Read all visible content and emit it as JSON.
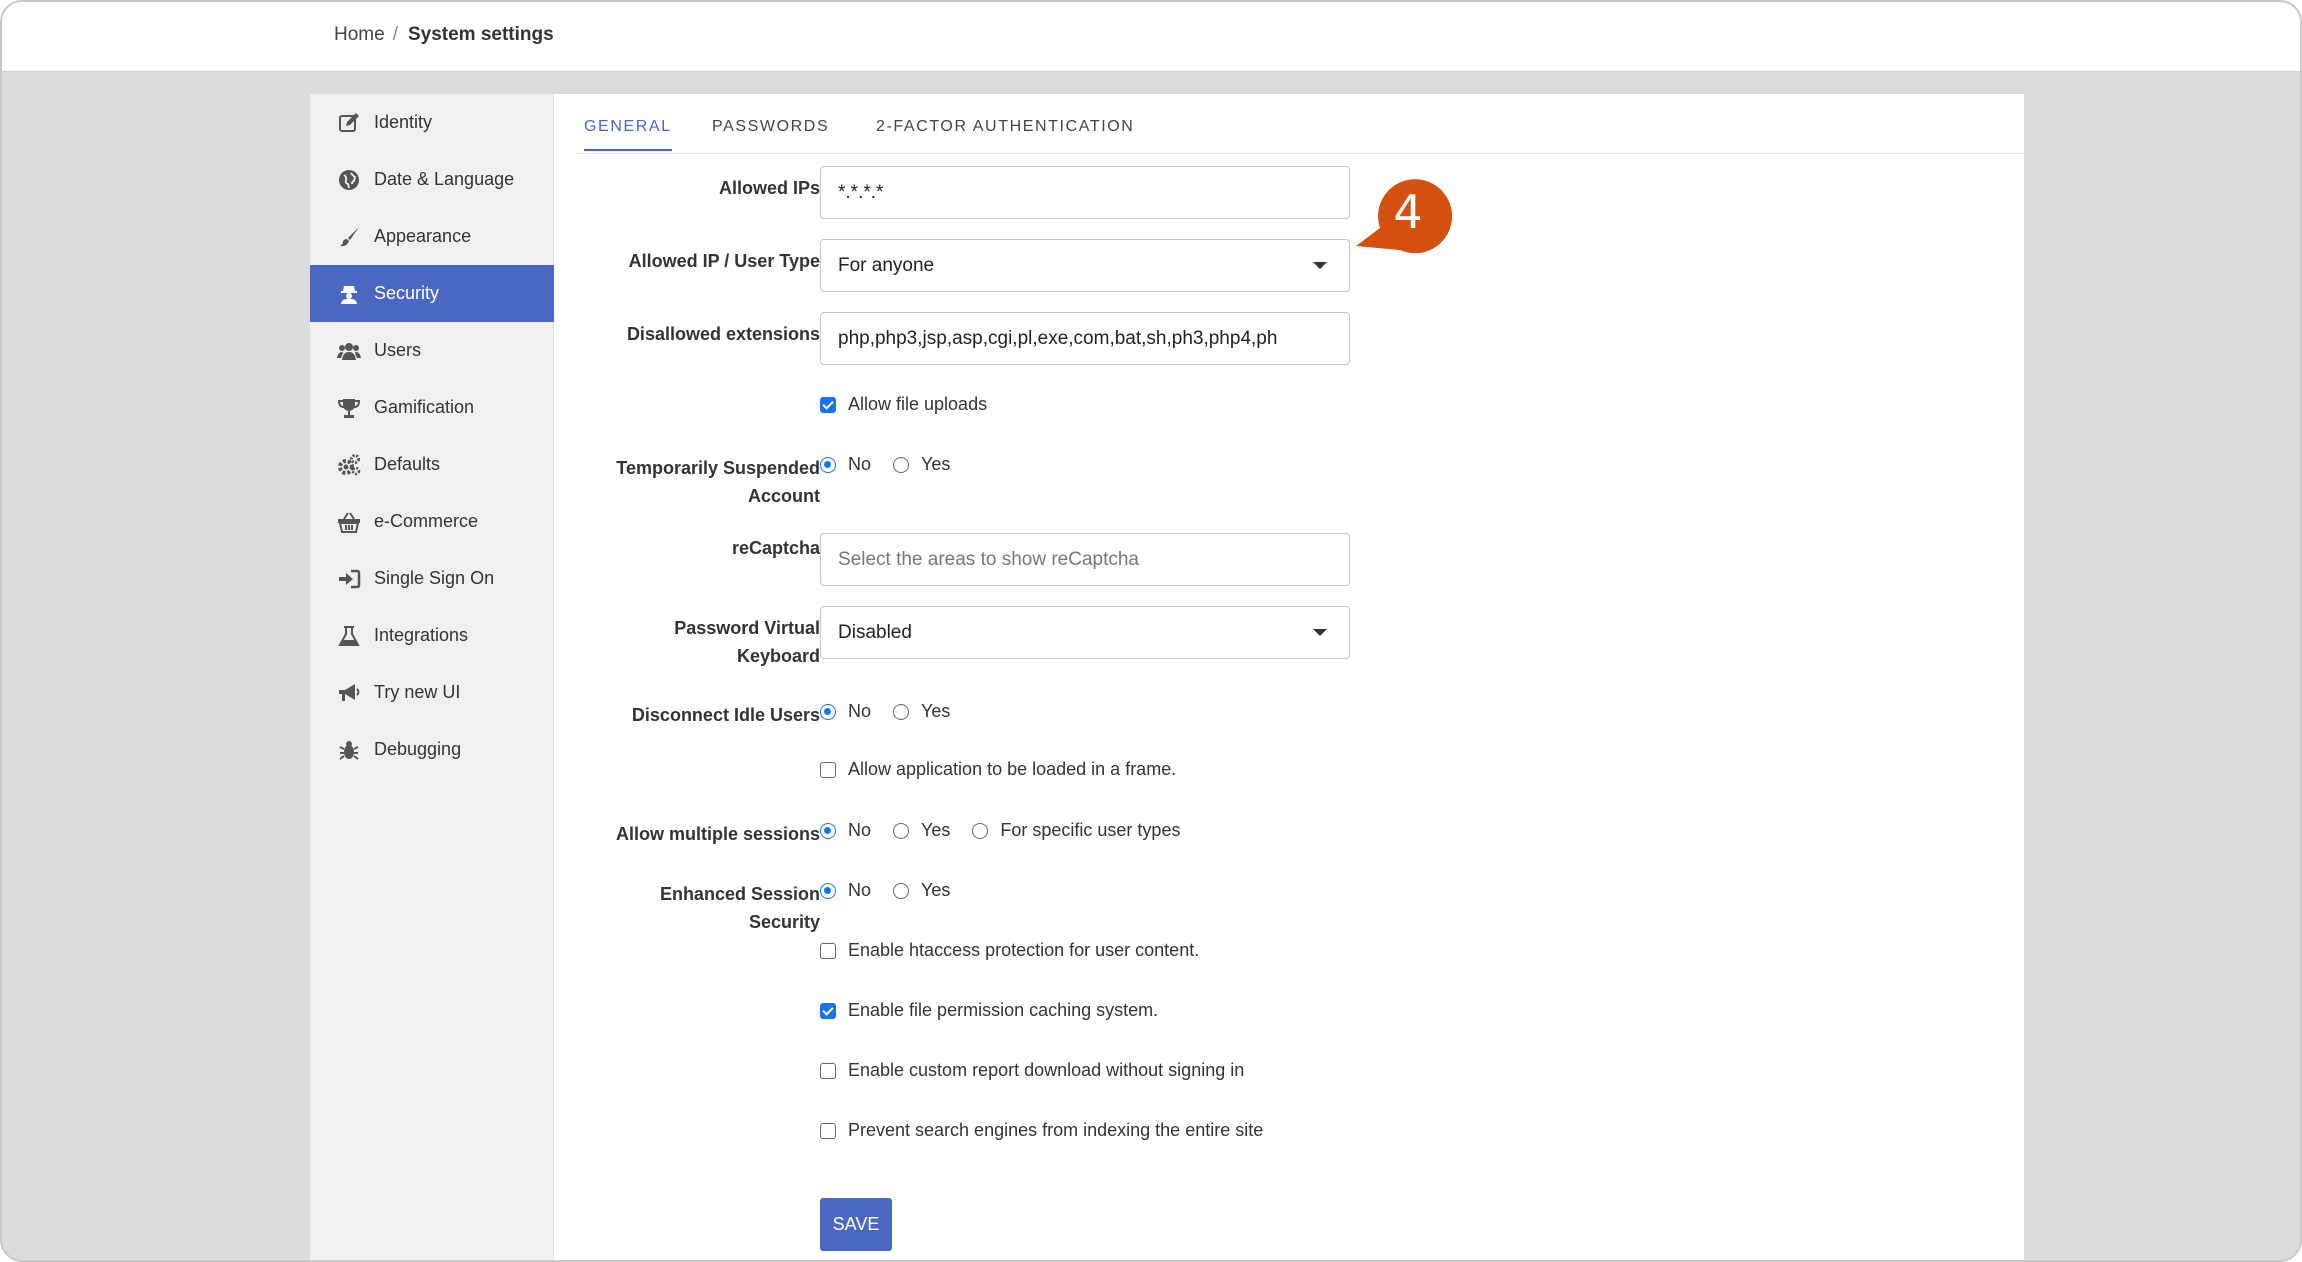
{
  "breadcrumb": {
    "home": "Home",
    "separator": "/",
    "current": "System settings"
  },
  "sidebar": {
    "items": [
      {
        "label": "Identity",
        "icon": "edit-icon"
      },
      {
        "label": "Date & Language",
        "icon": "globe-icon"
      },
      {
        "label": "Appearance",
        "icon": "brush-icon"
      },
      {
        "label": "Security",
        "icon": "user-secret-icon",
        "active": true
      },
      {
        "label": "Users",
        "icon": "users-icon"
      },
      {
        "label": "Gamification",
        "icon": "trophy-icon"
      },
      {
        "label": "Defaults",
        "icon": "gears-icon"
      },
      {
        "label": "e-Commerce",
        "icon": "basket-icon"
      },
      {
        "label": "Single Sign On",
        "icon": "sign-in-icon"
      },
      {
        "label": "Integrations",
        "icon": "flask-icon"
      },
      {
        "label": "Try new UI",
        "icon": "bullhorn-icon"
      },
      {
        "label": "Debugging",
        "icon": "bug-icon"
      }
    ]
  },
  "tabs": [
    {
      "label": "GENERAL",
      "active": true
    },
    {
      "label": "PASSWORDS"
    },
    {
      "label": "2-FACTOR AUTHENTICATION"
    }
  ],
  "form": {
    "allowed_ips": {
      "label": "Allowed IPs",
      "value": "*.*.*.*"
    },
    "allowed_ip_user_type": {
      "label": "Allowed IP / User Type",
      "value": "For anyone"
    },
    "disallowed_extensions": {
      "label": "Disallowed extensions",
      "value": "php,php3,jsp,asp,cgi,pl,exe,com,bat,sh,ph3,php4,ph"
    },
    "allow_file_uploads": {
      "label": "Allow file uploads",
      "checked": true
    },
    "temporarily_suspended": {
      "label_line1": "Temporarily Suspended",
      "label_line2": "Account",
      "options": [
        "No",
        "Yes"
      ],
      "selected": "No"
    },
    "recaptcha": {
      "label": "reCaptcha",
      "placeholder": "Select the areas to show reCaptcha"
    },
    "password_virtual_keyboard": {
      "label_line1": "Password Virtual",
      "label_line2": "Keyboard",
      "value": "Disabled"
    },
    "disconnect_idle_users": {
      "label": "Disconnect Idle Users",
      "options": [
        "No",
        "Yes"
      ],
      "selected": "No"
    },
    "allow_in_frame": {
      "label": "Allow application to be loaded in a frame.",
      "checked": false
    },
    "allow_multiple_sessions": {
      "label": "Allow multiple sessions",
      "options": [
        "No",
        "Yes",
        "For specific user types"
      ],
      "selected": "No"
    },
    "enhanced_session_security": {
      "label_line1": "Enhanced Session",
      "label_line2": "Security",
      "options": [
        "No",
        "Yes"
      ],
      "selected": "No"
    },
    "htaccess_protection": {
      "label": "Enable htaccess protection for user content.",
      "checked": false
    },
    "file_permission_caching": {
      "label": "Enable file permission caching system.",
      "checked": true
    },
    "custom_report_download": {
      "label": "Enable custom report download without signing in",
      "checked": false
    },
    "prevent_search_indexing": {
      "label": "Prevent search engines from indexing the entire site",
      "checked": false
    }
  },
  "save_label": "SAVE",
  "callout": {
    "number": "4",
    "color": "#d4500f"
  },
  "colors": {
    "accent": "#4a68c2",
    "radio": "#1a73e8"
  }
}
